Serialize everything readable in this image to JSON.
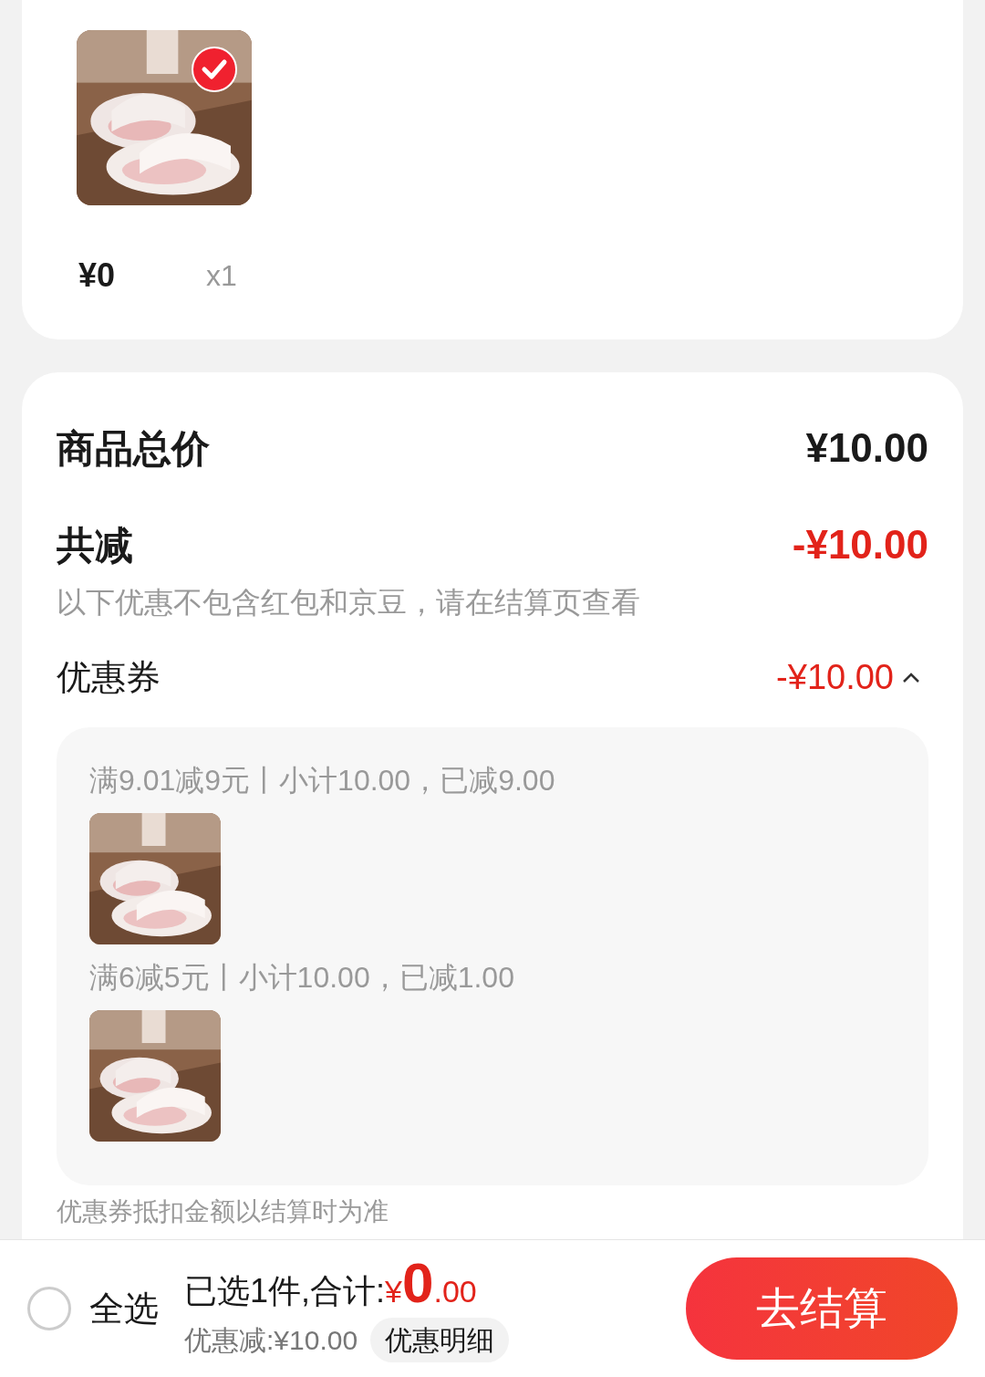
{
  "product": {
    "kind": "picture",
    "checked": true,
    "price": "¥0",
    "quantity": "x1"
  },
  "summary": {
    "total_label": "商品总价",
    "total_value": "¥10.00",
    "discount_label": "共减",
    "discount_value": "-¥10.00",
    "discount_note": "以下优惠不包含红包和京豆，请在结算页查看",
    "coupon": {
      "label": "优惠券",
      "value": "-¥10.00",
      "expanded": true,
      "rules": [
        {
          "text": "满9.01减9元丨小计10.00，已减9.00"
        },
        {
          "text": "满6减5元丨小计10.00，已减1.00"
        }
      ]
    },
    "footnote": "优惠券抵扣金额以结算时为准"
  },
  "bottom_bar": {
    "select_all": {
      "label": "全选",
      "checked": false
    },
    "selected_text": "已选1件,合计:",
    "currency": "¥",
    "amount_int": "0",
    "amount_dec": ".00",
    "discount": "优惠减:¥10.00",
    "detail_button": "优惠明细",
    "checkout_button": "去结算"
  }
}
